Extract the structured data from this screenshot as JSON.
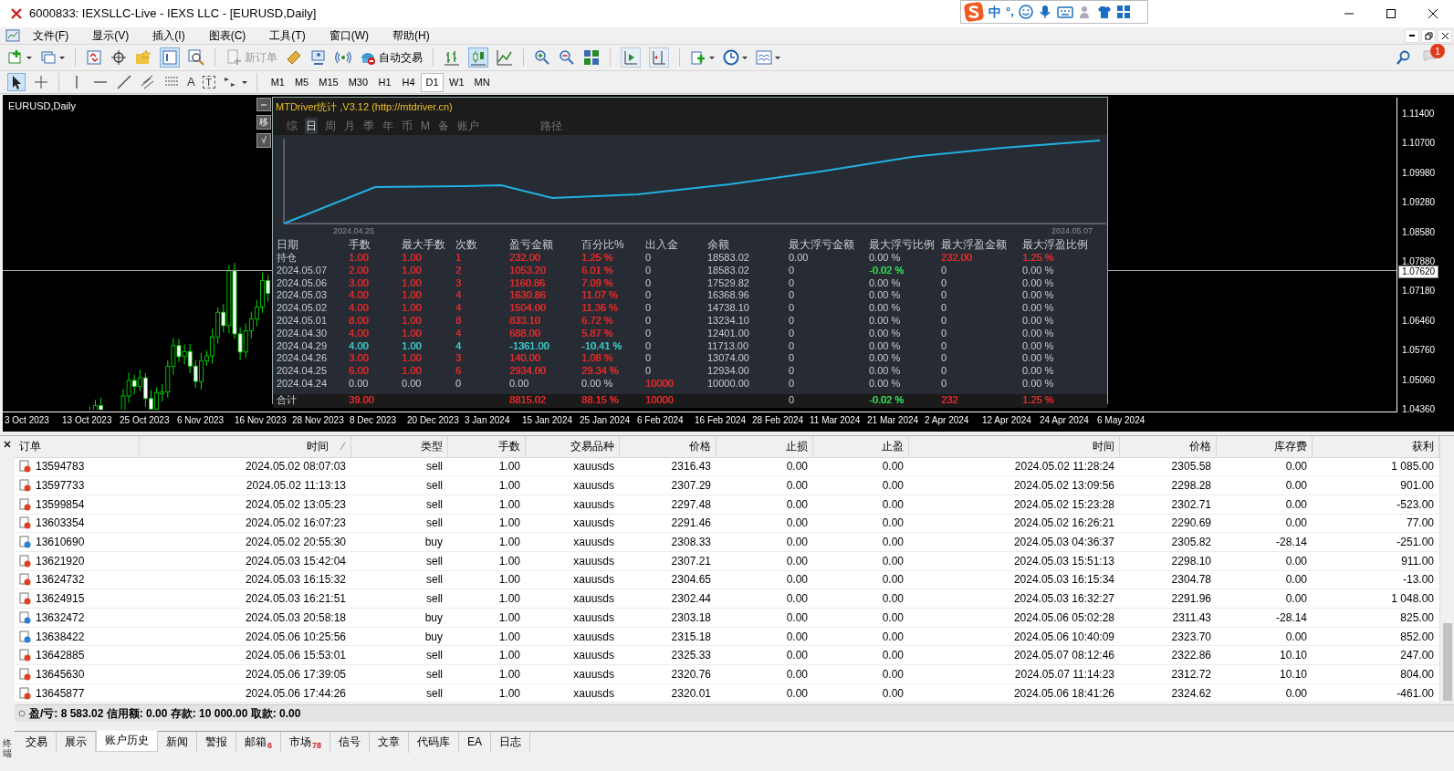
{
  "window": {
    "title": "6000833: IEXSLLC-Live - IEXS LLC - [EURUSD,Daily]"
  },
  "ime_bar": {
    "mode": "中",
    "punctuation": "°,"
  },
  "menu": [
    "文件(F)",
    "显示(V)",
    "插入(I)",
    "图表(C)",
    "工具(T)",
    "窗口(W)",
    "帮助(H)"
  ],
  "toolbar": {
    "new_order": {
      "label": "新订单",
      "disabled": true
    },
    "auto_trading": {
      "label": "自动交易"
    },
    "notifications": "1"
  },
  "drawing_tools": [
    {
      "glyph": "A"
    },
    {
      "glyph": "T"
    }
  ],
  "timeframes": [
    {
      "label": "M1",
      "selected": false
    },
    {
      "label": "M5",
      "selected": false
    },
    {
      "label": "M15",
      "selected": false
    },
    {
      "label": "M30",
      "selected": false
    },
    {
      "label": "H1",
      "selected": false
    },
    {
      "label": "H4",
      "selected": false
    },
    {
      "label": "D1",
      "selected": true
    },
    {
      "label": "W1",
      "selected": false
    },
    {
      "label": "MN",
      "selected": false
    }
  ],
  "chart": {
    "symbol": "EURUSD,Daily",
    "price_labels": [
      "1.11400",
      "1.10700",
      "1.09980",
      "1.09280",
      "1.08580",
      "1.07880",
      "1.07180",
      "1.06460",
      "1.05760",
      "1.05060",
      "1.04360"
    ],
    "current_price": "1.07620",
    "time_labels": [
      "3 Oct 2023",
      "13 Oct 2023",
      "25 Oct 2023",
      "6 Nov 2023",
      "16 Nov 2023",
      "28 Nov 2023",
      "8 Dec 2023",
      "20 Dec 2023",
      "3 Jan 2024",
      "15 Jan 2024",
      "25 Jan 2024",
      "6 Feb 2024",
      "16 Feb 2024",
      "28 Feb 2024",
      "11 Mar 2024",
      "21 Mar 2024",
      "2 Apr 2024",
      "12 Apr 2024",
      "24 Apr 2024",
      "6 May 2024"
    ],
    "side_buttons": [
      "移",
      "√"
    ]
  },
  "stats_panel": {
    "title": "MTDriver统计 ,V3.12 (http://mtdriver.cn)",
    "tabs": [
      {
        "label": "综",
        "selected": false
      },
      {
        "label": "日",
        "selected": true
      },
      {
        "label": "周",
        "selected": false
      },
      {
        "label": "月",
        "selected": false
      },
      {
        "label": "季",
        "selected": false
      },
      {
        "label": "年",
        "selected": false
      },
      {
        "label": "币",
        "selected": false
      },
      {
        "label": "M",
        "selected": false
      },
      {
        "label": "备",
        "selected": false
      },
      {
        "label": "账户",
        "selected": false
      },
      {
        "label": "路径",
        "selected": false
      }
    ],
    "curve_start": "2024.04.25",
    "curve_end": "2024.05.07",
    "columns": [
      "日期",
      "手数",
      "最大手数",
      "次数",
      "盈亏金额",
      "百分比%",
      "出入金",
      "余额",
      "最大浮亏金额",
      "最大浮亏比例",
      "最大浮盈金额",
      "最大浮盈比例"
    ],
    "rows": [
      [
        "持仓",
        {
          "text": "1.00",
          "color": "#e02a2a"
        },
        {
          "text": "1.00",
          "color": "#e02a2a"
        },
        {
          "text": "1",
          "color": "#e02a2a"
        },
        {
          "text": "232.00",
          "color": "#e02a2a"
        },
        {
          "text": "1.25 %",
          "color": "#e02a2a"
        },
        "0",
        "18583.02",
        "0.00",
        "0.00 %",
        {
          "text": "232.00",
          "color": "#e02a2a"
        },
        {
          "text": "1.25 %",
          "color": "#e02a2a"
        }
      ],
      [
        "2024.05.07",
        {
          "text": "2.00",
          "color": "#e02a2a"
        },
        {
          "text": "1.00",
          "color": "#e02a2a"
        },
        {
          "text": "2",
          "color": "#e02a2a"
        },
        {
          "text": "1053.20",
          "color": "#e02a2a"
        },
        {
          "text": "6.01 %",
          "color": "#e02a2a"
        },
        "0",
        "18583.02",
        "0",
        {
          "text": "-0.02 %",
          "color": "#33dd55"
        },
        "0",
        "0.00 %"
      ],
      [
        "2024.05.06",
        {
          "text": "3.00",
          "color": "#e02a2a"
        },
        {
          "text": "1.00",
          "color": "#e02a2a"
        },
        {
          "text": "3",
          "color": "#e02a2a"
        },
        {
          "text": "1160.86",
          "color": "#e02a2a"
        },
        {
          "text": "7.09 %",
          "color": "#e02a2a"
        },
        "0",
        "17529.82",
        "0",
        "0.00 %",
        "0",
        "0.00 %"
      ],
      [
        "2024.05.03",
        {
          "text": "4.00",
          "color": "#e02a2a"
        },
        {
          "text": "1.00",
          "color": "#e02a2a"
        },
        {
          "text": "4",
          "color": "#e02a2a"
        },
        {
          "text": "1630.86",
          "color": "#e02a2a"
        },
        {
          "text": "11.07 %",
          "color": "#e02a2a"
        },
        "0",
        "16368.96",
        "0",
        "0.00 %",
        "0",
        "0.00 %"
      ],
      [
        "2024.05.02",
        {
          "text": "4.00",
          "color": "#e02a2a"
        },
        {
          "text": "1.00",
          "color": "#e02a2a"
        },
        {
          "text": "4",
          "color": "#e02a2a"
        },
        {
          "text": "1504.00",
          "color": "#e02a2a"
        },
        {
          "text": "11.36 %",
          "color": "#e02a2a"
        },
        "0",
        "14738.10",
        "0",
        "0.00 %",
        "0",
        "0.00 %"
      ],
      [
        "2024.05.01",
        {
          "text": "8.00",
          "color": "#e02a2a"
        },
        {
          "text": "1.00",
          "color": "#e02a2a"
        },
        {
          "text": "8",
          "color": "#e02a2a"
        },
        {
          "text": "833.10",
          "color": "#e02a2a"
        },
        {
          "text": "6.72 %",
          "color": "#e02a2a"
        },
        "0",
        "13234.10",
        "0",
        "0.00 %",
        "0",
        "0.00 %"
      ],
      [
        "2024.04.30",
        {
          "text": "4.00",
          "color": "#e02a2a"
        },
        {
          "text": "1.00",
          "color": "#e02a2a"
        },
        {
          "text": "4",
          "color": "#e02a2a"
        },
        {
          "text": "688.00",
          "color": "#e02a2a"
        },
        {
          "text": "5.87 %",
          "color": "#e02a2a"
        },
        "0",
        "12401.00",
        "0",
        "0.00 %",
        "0",
        "0.00 %"
      ],
      [
        "2024.04.29",
        {
          "text": "4.00",
          "color": "#3cc8c8"
        },
        {
          "text": "1.00",
          "color": "#3cc8c8"
        },
        {
          "text": "4",
          "color": "#3cc8c8"
        },
        {
          "text": "-1361.00",
          "color": "#3cc8c8"
        },
        {
          "text": "-10.41 %",
          "color": "#3cc8c8"
        },
        "0",
        "11713.00",
        "0",
        "0.00 %",
        "0",
        "0.00 %"
      ],
      [
        "2024.04.26",
        {
          "text": "3.00",
          "color": "#e02a2a"
        },
        {
          "text": "1.00",
          "color": "#e02a2a"
        },
        {
          "text": "3",
          "color": "#e02a2a"
        },
        {
          "text": "140.00",
          "color": "#e02a2a"
        },
        {
          "text": "1.08 %",
          "color": "#e02a2a"
        },
        "0",
        "13074.00",
        "0",
        "0.00 %",
        "0",
        "0.00 %"
      ],
      [
        "2024.04.25",
        {
          "text": "6.00",
          "color": "#e02a2a"
        },
        {
          "text": "1.00",
          "color": "#e02a2a"
        },
        {
          "text": "6",
          "color": "#e02a2a"
        },
        {
          "text": "2934.00",
          "color": "#e02a2a"
        },
        {
          "text": "29.34 %",
          "color": "#e02a2a"
        },
        "0",
        "12934.00",
        "0",
        "0.00 %",
        "0",
        "0.00 %"
      ],
      [
        "2024.04.24",
        "0.00",
        "0.00",
        "0",
        "0.00",
        "0.00 %",
        {
          "text": "10000",
          "color": "#e02a2a"
        },
        "10000.00",
        "0",
        "0.00 %",
        "0",
        "0.00 %"
      ]
    ],
    "total": {
      "label": "合计",
      "lots": {
        "text": "39.00",
        "color": "#e02a2a"
      },
      "pnl": {
        "text": "8815.02",
        "color": "#e02a2a"
      },
      "percent": {
        "text": "88.15 %",
        "color": "#e02a2a"
      },
      "deposit": {
        "text": "10000",
        "color": "#e02a2a"
      },
      "max_float_loss": "0",
      "max_float_loss_pct": {
        "text": "-0.02 %",
        "color": "#33dd55"
      },
      "max_float_profit": {
        "text": "232",
        "color": "#e02a2a"
      },
      "max_float_profit_pct": {
        "text": "1.25 %",
        "color": "#e02a2a"
      }
    }
  },
  "terminal": {
    "side_label": "终端",
    "columns": [
      "订单",
      "时间",
      "类型",
      "手数",
      "交易品种",
      "价格",
      "止损",
      "止盈",
      "时间",
      "价格",
      "库存费",
      "获利"
    ],
    "rows": [
      {
        "kind": "sell",
        "cells": [
          "13594783",
          "2024.05.02 08:07:03",
          "sell",
          "1.00",
          "xauusds",
          "2316.43",
          "0.00",
          "0.00",
          "2024.05.02 11:28:24",
          "2305.58",
          "0.00",
          "1 085.00"
        ]
      },
      {
        "kind": "sell",
        "cells": [
          "13597733",
          "2024.05.02 11:13:13",
          "sell",
          "1.00",
          "xauusds",
          "2307.29",
          "0.00",
          "0.00",
          "2024.05.02 13:09:56",
          "2298.28",
          "0.00",
          "901.00"
        ]
      },
      {
        "kind": "sell",
        "cells": [
          "13599854",
          "2024.05.02 13:05:23",
          "sell",
          "1.00",
          "xauusds",
          "2297.48",
          "0.00",
          "0.00",
          "2024.05.02 15:23:28",
          "2302.71",
          "0.00",
          "-523.00"
        ]
      },
      {
        "kind": "sell",
        "cells": [
          "13603354",
          "2024.05.02 16:07:23",
          "sell",
          "1.00",
          "xauusds",
          "2291.46",
          "0.00",
          "0.00",
          "2024.05.02 16:26:21",
          "2290.69",
          "0.00",
          "77.00"
        ]
      },
      {
        "kind": "buy",
        "cells": [
          "13610690",
          "2024.05.02 20:55:30",
          "buy",
          "1.00",
          "xauusds",
          "2308.33",
          "0.00",
          "0.00",
          "2024.05.03 04:36:37",
          "2305.82",
          "-28.14",
          "-251.00"
        ]
      },
      {
        "kind": "sell",
        "cells": [
          "13621920",
          "2024.05.03 15:42:04",
          "sell",
          "1.00",
          "xauusds",
          "2307.21",
          "0.00",
          "0.00",
          "2024.05.03 15:51:13",
          "2298.10",
          "0.00",
          "911.00"
        ]
      },
      {
        "kind": "sell",
        "cells": [
          "13624732",
          "2024.05.03 16:15:32",
          "sell",
          "1.00",
          "xauusds",
          "2304.65",
          "0.00",
          "0.00",
          "2024.05.03 16:15:34",
          "2304.78",
          "0.00",
          "-13.00"
        ]
      },
      {
        "kind": "sell",
        "cells": [
          "13624915",
          "2024.05.03 16:21:51",
          "sell",
          "1.00",
          "xauusds",
          "2302.44",
          "0.00",
          "0.00",
          "2024.05.03 16:32:27",
          "2291.96",
          "0.00",
          "1 048.00"
        ]
      },
      {
        "kind": "buy",
        "cells": [
          "13632472",
          "2024.05.03 20:58:18",
          "buy",
          "1.00",
          "xauusds",
          "2303.18",
          "0.00",
          "0.00",
          "2024.05.06 05:02:28",
          "2311.43",
          "-28.14",
          "825.00"
        ]
      },
      {
        "kind": "buy",
        "cells": [
          "13638422",
          "2024.05.06 10:25:56",
          "buy",
          "1.00",
          "xauusds",
          "2315.18",
          "0.00",
          "0.00",
          "2024.05.06 10:40:09",
          "2323.70",
          "0.00",
          "852.00"
        ]
      },
      {
        "kind": "sell",
        "cells": [
          "13642885",
          "2024.05.06 15:53:01",
          "sell",
          "1.00",
          "xauusds",
          "2325.33",
          "0.00",
          "0.00",
          "2024.05.07 08:12:46",
          "2322.86",
          "10.10",
          "247.00"
        ]
      },
      {
        "kind": "sell",
        "cells": [
          "13645630",
          "2024.05.06 17:39:05",
          "sell",
          "1.00",
          "xauusds",
          "2320.76",
          "0.00",
          "0.00",
          "2024.05.07 11:14:23",
          "2312.72",
          "10.10",
          "804.00"
        ]
      },
      {
        "kind": "sell",
        "cells": [
          "13645877",
          "2024.05.06 17:44:26",
          "sell",
          "1.00",
          "xauusds",
          "2320.01",
          "0.00",
          "0.00",
          "2024.05.06 18:41:26",
          "2324.62",
          "0.00",
          "-461.00"
        ]
      }
    ],
    "summary": "盈/亏: 8 583.02 信用额: 0.00 存款: 10 000.00 取款: 0.00",
    "tabs": [
      {
        "label": "交易",
        "selected": false
      },
      {
        "label": "展示",
        "selected": false
      },
      {
        "label": "账户历史",
        "selected": true
      },
      {
        "label": "新闻",
        "selected": false
      },
      {
        "label": "警报",
        "selected": false
      },
      {
        "label": "邮箱",
        "badge": "6",
        "selected": false
      },
      {
        "label": "市场",
        "badge": "78",
        "selected": false
      },
      {
        "label": "信号",
        "selected": false
      },
      {
        "label": "文章",
        "selected": false
      },
      {
        "label": "代码库",
        "selected": false
      },
      {
        "label": "EA",
        "selected": false
      },
      {
        "label": "日志",
        "selected": false
      }
    ]
  }
}
